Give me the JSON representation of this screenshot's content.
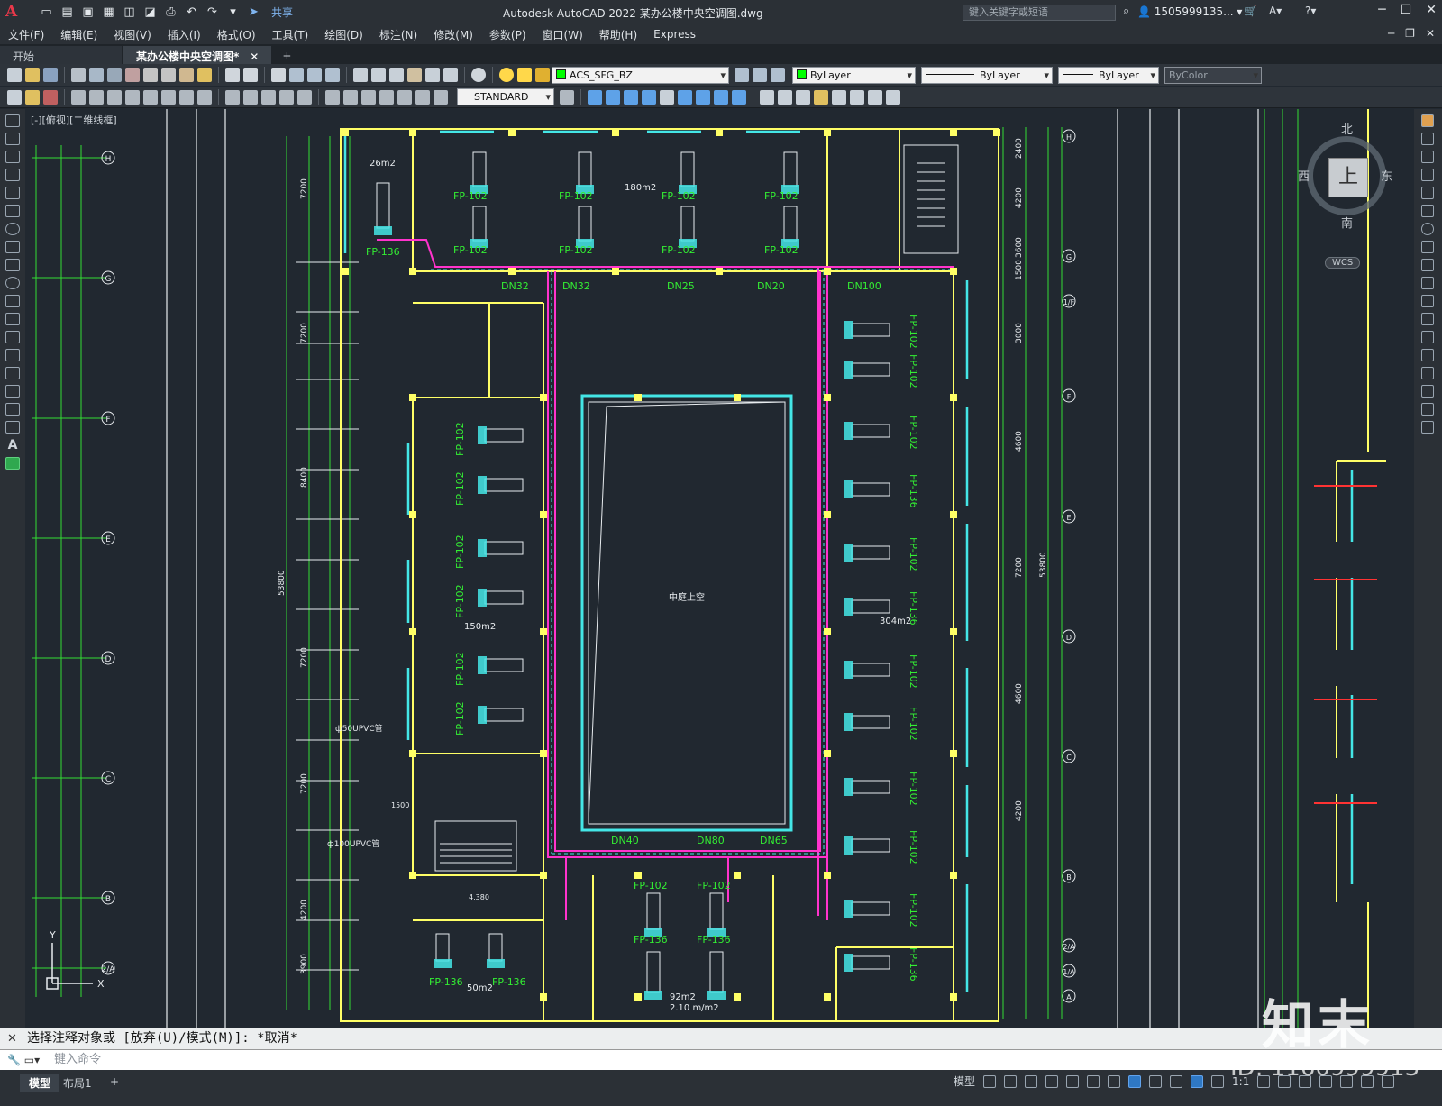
{
  "app": {
    "title": "Autodesk AutoCAD 2022    某办公楼中央空调图.dwg",
    "search_placeholder": "键入关键字或短语",
    "user": "1505999135...",
    "share_label": "共享"
  },
  "menu": {
    "items": [
      "文件(F)",
      "编辑(E)",
      "视图(V)",
      "插入(I)",
      "格式(O)",
      "工具(T)",
      "绘图(D)",
      "标注(N)",
      "修改(M)",
      "参数(P)",
      "窗口(W)",
      "帮助(H)",
      "Express"
    ]
  },
  "tabs": {
    "items": [
      {
        "label": "开始"
      },
      {
        "label": "某办公楼中央空调图*"
      }
    ]
  },
  "toolbar": {
    "layer": "ACS_SFG_BZ",
    "color": "ByLayer",
    "linetype": "ByLayer",
    "lineweight": "ByLayer",
    "plotstyle": "ByColor",
    "textstyle": "STANDARD",
    "layer_color": "#00ff00"
  },
  "viewport": {
    "label": "[-][俯视][二维线框]",
    "viewcube": {
      "north": "北",
      "south": "南",
      "east": "东",
      "west": "西",
      "face": "上",
      "wcs": "WCS"
    }
  },
  "drawing": {
    "grid_left": [
      "H",
      "G",
      "F",
      "E",
      "D",
      "C",
      "B",
      "2/A"
    ],
    "grid_right": [
      "H",
      "G",
      "1/F",
      "F",
      "E",
      "D",
      "C",
      "B",
      "2/A",
      "1/A",
      "A"
    ],
    "rooms": [
      {
        "name": "26m2"
      },
      {
        "name": "180m2"
      },
      {
        "name": "150m2"
      },
      {
        "name": "304m2"
      },
      {
        "name": "50m2"
      },
      {
        "name": "92m2"
      },
      {
        "name": "2.10 m/m2"
      }
    ],
    "units_top": [
      "FP-102",
      "FP-102",
      "FP-102",
      "FP-102"
    ],
    "units_top2": [
      "FP-102",
      "FP-102",
      "FP-102",
      "FP-102"
    ],
    "unit_corner": "FP-136",
    "pipes_top": [
      "DN32",
      "DN32",
      "DN25",
      "DN20",
      "DN100"
    ],
    "left_units": [
      "FP-102",
      "FP-102",
      "FP-102",
      "FP-102",
      "FP-102",
      "FP-102"
    ],
    "right_units": [
      "FP-102",
      "FP-102",
      "FP-102",
      "FP-136",
      "FP-102",
      "FP-136",
      "FP-102",
      "FP-102",
      "FP-102",
      "FP-102",
      "FP-102",
      "FP-136"
    ],
    "bottom_units": [
      "FP-102",
      "FP-102",
      "FP-136",
      "FP-136",
      "FP-136",
      "FP-136"
    ],
    "bottom_pipes": [
      "DN40",
      "DN80",
      "DN65"
    ],
    "notes": [
      "ф50UPVC管",
      "ф100UPVC管",
      "1500",
      "4.380"
    ],
    "dims_left": [
      "53800",
      "7200",
      "7200",
      "8400",
      "7200",
      "7200",
      "4200",
      "3900"
    ],
    "dims_right": [
      "2400",
      "4200",
      "3600",
      "1500",
      "3000",
      "4600",
      "7200",
      "4600",
      "4200",
      "53800"
    ],
    "atrium_label": "中庭上空"
  },
  "command": {
    "history": "选择注释对象或 [放弃(U)/模式(M)]: *取消*",
    "placeholder": "键入命令"
  },
  "status": {
    "model_tab": "模型",
    "layout_tab": "布局1",
    "model_label": "模型",
    "scale": "1:1"
  },
  "watermark": {
    "logo": "知末",
    "id": "ID: 1160999913"
  }
}
